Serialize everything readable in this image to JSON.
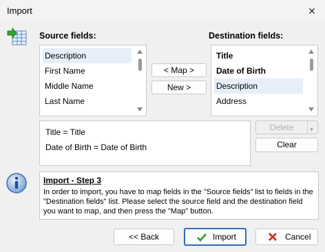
{
  "window": {
    "title": "Import",
    "close_glyph": "✕"
  },
  "source": {
    "label": "Source fields:",
    "items": [
      {
        "label": "Description",
        "selected": true
      },
      {
        "label": "First Name"
      },
      {
        "label": "Middle Name"
      },
      {
        "label": "Last Name"
      }
    ]
  },
  "destination": {
    "label": "Destination fields:",
    "items": [
      {
        "label": "Title",
        "bold": true
      },
      {
        "label": "Date of Birth",
        "bold": true
      },
      {
        "label": "Description",
        "selected": true
      },
      {
        "label": "Address"
      }
    ]
  },
  "buttons": {
    "map": "< Map >",
    "new": "New >",
    "delete": "Delete",
    "clear": "Clear",
    "back": "<< Back",
    "import": "Import",
    "cancel": "Cancel"
  },
  "mappings": [
    "Title = Title",
    "Date of Birth = Date of Birth"
  ],
  "info": {
    "heading": "Import - Step 3",
    "text": "In order to import, you have to map fields in the \"Source fields\" list to fields in the \"Destination fields\" list. Please select the source field and the destination field you want to map, and then press the \"Map\" button."
  },
  "icons": {
    "import": "import-table-icon",
    "info": "info-icon",
    "check": "check-icon",
    "cancel_x": "red-x-icon"
  },
  "colors": {
    "accent": "#2d6cb5",
    "selection": "#e6eef8",
    "check": "#3aa53a",
    "cancel": "#d9342b"
  }
}
